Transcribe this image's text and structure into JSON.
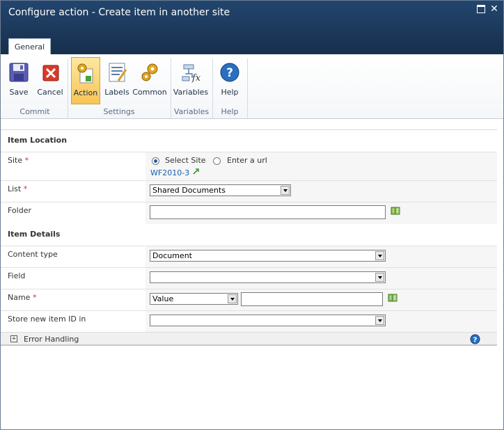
{
  "window": {
    "title": "Configure action - Create item in another site"
  },
  "ribbon": {
    "tab": "General",
    "buttons": {
      "save": "Save",
      "cancel": "Cancel",
      "action": "Action",
      "labels": "Labels",
      "common": "Common",
      "variables": "Variables",
      "help": "Help"
    },
    "groups": {
      "commit": "Commit",
      "settings": "Settings",
      "variables": "Variables",
      "help": "Help"
    }
  },
  "form": {
    "item_location": "Item Location",
    "site": {
      "label": "Site",
      "option_select": "Select Site",
      "option_url": "Enter a url",
      "selected_site": "WF2010-3"
    },
    "list": {
      "label": "List",
      "value": "Shared Documents"
    },
    "folder": {
      "label": "Folder",
      "value": ""
    },
    "item_details": "Item Details",
    "content_type": {
      "label": "Content type",
      "value": "Document"
    },
    "field": {
      "label": "Field",
      "value": ""
    },
    "name": {
      "label": "Name",
      "type_value": "Value",
      "value": ""
    },
    "store_id": {
      "label": "Store new item ID in",
      "value": ""
    },
    "required_mark": "*",
    "error_handling": "Error Handling"
  },
  "colors": {
    "titlebar": "#1d3b5e",
    "selected_button": "#f8c457",
    "link": "#1660b0",
    "required": "#d12d2d"
  }
}
